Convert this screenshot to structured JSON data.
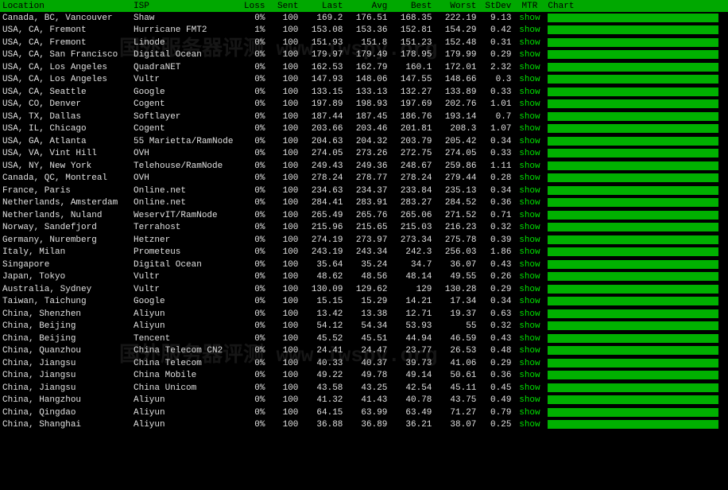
{
  "watermark_text": "国外服务器评测 www.iwspy.org",
  "headers": {
    "location": "Location",
    "isp": "ISP",
    "loss": "Loss",
    "sent": "Sent",
    "last": "Last",
    "avg": "Avg",
    "best": "Best",
    "worst": "Worst",
    "stdev": "StDev",
    "mtr": "MTR",
    "chart": "Chart"
  },
  "mtr_link": "show",
  "rows": [
    {
      "location": "Canada, BC, Vancouver",
      "isp": "Shaw",
      "loss": "0%",
      "sent": "100",
      "last": "169.2",
      "avg": "176.51",
      "best": "168.35",
      "worst": "222.19",
      "stdev": "9.13"
    },
    {
      "location": "USA, CA, Fremont",
      "isp": "Hurricane FMT2",
      "loss": "1%",
      "sent": "100",
      "last": "153.08",
      "avg": "153.36",
      "best": "152.81",
      "worst": "154.29",
      "stdev": "0.42"
    },
    {
      "location": "USA, CA, Fremont",
      "isp": "Linode",
      "loss": "0%",
      "sent": "100",
      "last": "151.93",
      "avg": "151.8",
      "best": "151.23",
      "worst": "152.48",
      "stdev": "0.31"
    },
    {
      "location": "USA, CA, San Francisco",
      "isp": "Digital Ocean",
      "loss": "0%",
      "sent": "100",
      "last": "179.97",
      "avg": "179.49",
      "best": "178.95",
      "worst": "179.99",
      "stdev": "0.29"
    },
    {
      "location": "USA, CA, Los Angeles",
      "isp": "QuadraNET",
      "loss": "0%",
      "sent": "100",
      "last": "162.53",
      "avg": "162.79",
      "best": "160.1",
      "worst": "172.01",
      "stdev": "2.32"
    },
    {
      "location": "USA, CA, Los Angeles",
      "isp": "Vultr",
      "loss": "0%",
      "sent": "100",
      "last": "147.93",
      "avg": "148.06",
      "best": "147.55",
      "worst": "148.66",
      "stdev": "0.3"
    },
    {
      "location": "USA, CA, Seattle",
      "isp": "Google",
      "loss": "0%",
      "sent": "100",
      "last": "133.15",
      "avg": "133.13",
      "best": "132.27",
      "worst": "133.89",
      "stdev": "0.33"
    },
    {
      "location": "USA, CO, Denver",
      "isp": "Cogent",
      "loss": "0%",
      "sent": "100",
      "last": "197.89",
      "avg": "198.93",
      "best": "197.69",
      "worst": "202.76",
      "stdev": "1.01"
    },
    {
      "location": "USA, TX, Dallas",
      "isp": "Softlayer",
      "loss": "0%",
      "sent": "100",
      "last": "187.44",
      "avg": "187.45",
      "best": "186.76",
      "worst": "193.14",
      "stdev": "0.7"
    },
    {
      "location": "USA, IL, Chicago",
      "isp": "Cogent",
      "loss": "0%",
      "sent": "100",
      "last": "203.66",
      "avg": "203.46",
      "best": "201.81",
      "worst": "208.3",
      "stdev": "1.07"
    },
    {
      "location": "USA, GA, Atlanta",
      "isp": "55 Marietta/RamNode",
      "loss": "0%",
      "sent": "100",
      "last": "204.63",
      "avg": "204.32",
      "best": "203.79",
      "worst": "205.42",
      "stdev": "0.34"
    },
    {
      "location": "USA, VA, Vint Hill",
      "isp": "OVH",
      "loss": "0%",
      "sent": "100",
      "last": "274.05",
      "avg": "273.26",
      "best": "272.75",
      "worst": "274.05",
      "stdev": "0.33"
    },
    {
      "location": "USA, NY, New York",
      "isp": "Telehouse/RamNode",
      "loss": "0%",
      "sent": "100",
      "last": "249.43",
      "avg": "249.36",
      "best": "248.67",
      "worst": "259.86",
      "stdev": "1.11"
    },
    {
      "location": "Canada, QC, Montreal",
      "isp": "OVH",
      "loss": "0%",
      "sent": "100",
      "last": "278.24",
      "avg": "278.77",
      "best": "278.24",
      "worst": "279.44",
      "stdev": "0.28"
    },
    {
      "location": "France, Paris",
      "isp": "Online.net",
      "loss": "0%",
      "sent": "100",
      "last": "234.63",
      "avg": "234.37",
      "best": "233.84",
      "worst": "235.13",
      "stdev": "0.34"
    },
    {
      "location": "Netherlands, Amsterdam",
      "isp": "Online.net",
      "loss": "0%",
      "sent": "100",
      "last": "284.41",
      "avg": "283.91",
      "best": "283.27",
      "worst": "284.52",
      "stdev": "0.36"
    },
    {
      "location": "Netherlands, Nuland",
      "isp": "WeservIT/RamNode",
      "loss": "0%",
      "sent": "100",
      "last": "265.49",
      "avg": "265.76",
      "best": "265.06",
      "worst": "271.52",
      "stdev": "0.71"
    },
    {
      "location": "Norway, Sandefjord",
      "isp": "Terrahost",
      "loss": "0%",
      "sent": "100",
      "last": "215.96",
      "avg": "215.65",
      "best": "215.03",
      "worst": "216.23",
      "stdev": "0.32"
    },
    {
      "location": "Germany, Nuremberg",
      "isp": "Hetzner",
      "loss": "0%",
      "sent": "100",
      "last": "274.19",
      "avg": "273.97",
      "best": "273.34",
      "worst": "275.78",
      "stdev": "0.39"
    },
    {
      "location": "Italy, Milan",
      "isp": "Prometeus",
      "loss": "0%",
      "sent": "100",
      "last": "243.19",
      "avg": "243.34",
      "best": "242.3",
      "worst": "256.03",
      "stdev": "1.86"
    },
    {
      "location": "Singapore",
      "isp": "Digital Ocean",
      "loss": "0%",
      "sent": "100",
      "last": "35.64",
      "avg": "35.24",
      "best": "34.7",
      "worst": "36.07",
      "stdev": "0.43"
    },
    {
      "location": "Japan, Tokyo",
      "isp": "Vultr",
      "loss": "0%",
      "sent": "100",
      "last": "48.62",
      "avg": "48.56",
      "best": "48.14",
      "worst": "49.55",
      "stdev": "0.26"
    },
    {
      "location": "Australia, Sydney",
      "isp": "Vultr",
      "loss": "0%",
      "sent": "100",
      "last": "130.09",
      "avg": "129.62",
      "best": "129",
      "worst": "130.28",
      "stdev": "0.29"
    },
    {
      "location": "Taiwan, Taichung",
      "isp": "Google",
      "loss": "0%",
      "sent": "100",
      "last": "15.15",
      "avg": "15.29",
      "best": "14.21",
      "worst": "17.34",
      "stdev": "0.34"
    },
    {
      "location": "China, Shenzhen",
      "isp": "Aliyun",
      "loss": "0%",
      "sent": "100",
      "last": "13.42",
      "avg": "13.38",
      "best": "12.71",
      "worst": "19.37",
      "stdev": "0.63"
    },
    {
      "location": "China, Beijing",
      "isp": "Aliyun",
      "loss": "0%",
      "sent": "100",
      "last": "54.12",
      "avg": "54.34",
      "best": "53.93",
      "worst": "55",
      "stdev": "0.32"
    },
    {
      "location": "China, Beijing",
      "isp": "Tencent",
      "loss": "0%",
      "sent": "100",
      "last": "45.52",
      "avg": "45.51",
      "best": "44.94",
      "worst": "46.59",
      "stdev": "0.43"
    },
    {
      "location": "China, Quanzhou",
      "isp": "China Telecom CN2",
      "loss": "0%",
      "sent": "100",
      "last": "24.41",
      "avg": "24.47",
      "best": "23.77",
      "worst": "26.53",
      "stdev": "0.48"
    },
    {
      "location": "China, Jiangsu",
      "isp": "China Telecom",
      "loss": "0%",
      "sent": "100",
      "last": "40.33",
      "avg": "40.37",
      "best": "39.73",
      "worst": "41.06",
      "stdev": "0.29"
    },
    {
      "location": "China, Jiangsu",
      "isp": "China Mobile",
      "loss": "0%",
      "sent": "100",
      "last": "49.22",
      "avg": "49.78",
      "best": "49.14",
      "worst": "50.61",
      "stdev": "0.36"
    },
    {
      "location": "China, Jiangsu",
      "isp": "China Unicom",
      "loss": "0%",
      "sent": "100",
      "last": "43.58",
      "avg": "43.25",
      "best": "42.54",
      "worst": "45.11",
      "stdev": "0.45"
    },
    {
      "location": "China, Hangzhou",
      "isp": "Aliyun",
      "loss": "0%",
      "sent": "100",
      "last": "41.32",
      "avg": "41.43",
      "best": "40.78",
      "worst": "43.75",
      "stdev": "0.49"
    },
    {
      "location": "China, Qingdao",
      "isp": "Aliyun",
      "loss": "0%",
      "sent": "100",
      "last": "64.15",
      "avg": "63.99",
      "best": "63.49",
      "worst": "71.27",
      "stdev": "0.79"
    },
    {
      "location": "China, Shanghai",
      "isp": "Aliyun",
      "loss": "0%",
      "sent": "100",
      "last": "36.88",
      "avg": "36.89",
      "best": "36.21",
      "worst": "38.07",
      "stdev": "0.25"
    }
  ]
}
